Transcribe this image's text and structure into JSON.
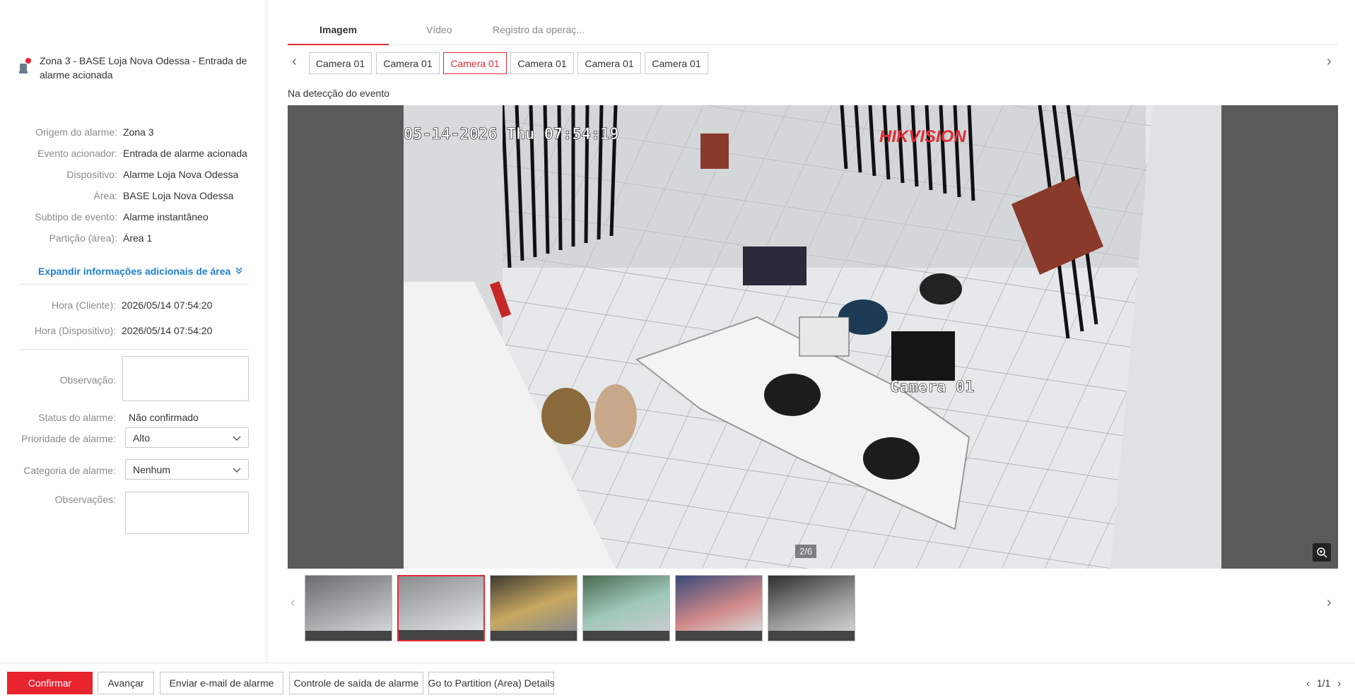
{
  "alarm": {
    "title": "Zona 3 - BASE Loja Nova Odessa - Entrada de alarme acionada",
    "icon": "alarm-bell-icon"
  },
  "details": [
    {
      "label": "Origem do alarme:",
      "value": "Zona 3"
    },
    {
      "label": "Evento acionador:",
      "value": "Entrada de alarme acionada"
    },
    {
      "label": "Dispositivo:",
      "value": "Alarme Loja Nova Odessa"
    },
    {
      "label": "Área:",
      "value": "BASE Loja Nova Odessa"
    },
    {
      "label": "Subtipo de evento:",
      "value": "Alarme instantâneo"
    },
    {
      "label": "Partição (área):",
      "value": "Área 1"
    }
  ],
  "expand_label": "Expandir informações adicionais de área",
  "times": [
    {
      "label": "Hora (Cliente):",
      "value": "2026/05/14 07:54:20"
    },
    {
      "label": "Hora (Dispositivo):",
      "value": "2026/05/14 07:54:20"
    }
  ],
  "form": {
    "observation_label": "Observação:",
    "status_label": "Status do alarme:",
    "status_value": "Não confirmado",
    "priority_label": "Prioridade de alarme:",
    "priority_value": "Alto",
    "category_label": "Categoria de alarme:",
    "category_value": "Nenhum",
    "remarks_label": "Observações:"
  },
  "tabs": [
    {
      "label": "Imagem",
      "active": true
    },
    {
      "label": "Vídeo",
      "active": false
    },
    {
      "label": "Registro da operaç...",
      "active": false
    }
  ],
  "cameras": [
    {
      "label": "Camera 01",
      "active": false
    },
    {
      "label": "Camera 01",
      "active": false
    },
    {
      "label": "Camera 01",
      "active": true
    },
    {
      "label": "Camera 01",
      "active": false
    },
    {
      "label": "Camera 01",
      "active": false
    },
    {
      "label": "Camera 01",
      "active": false
    }
  ],
  "caption": "Na detecção do evento",
  "image": {
    "timestamp_overlay": "05-14-2026 Thu 07:54:19",
    "brand_overlay": "HIKVISION",
    "camera_overlay": "Camera 01",
    "counter": "2/6"
  },
  "thumbnails": [
    {
      "active": false,
      "tone": "#8d8f91"
    },
    {
      "active": true,
      "tone": "#b9bcbe"
    },
    {
      "active": false,
      "tone": "#7c6a4a"
    },
    {
      "active": false,
      "tone": "#6f8d76"
    },
    {
      "active": false,
      "tone": "#7a7f92"
    },
    {
      "active": false,
      "tone": "#6a6a6a"
    }
  ],
  "footer": {
    "confirm": "Confirmar",
    "advance": "Avançar",
    "email": "Enviar e-mail de alarme",
    "exit_control": "Controle de saída de alarme",
    "partition": "Go to Partition (Area) Details",
    "pager": "1/1"
  },
  "colors": {
    "accent": "#e8242e",
    "link": "#1f7fd1"
  }
}
